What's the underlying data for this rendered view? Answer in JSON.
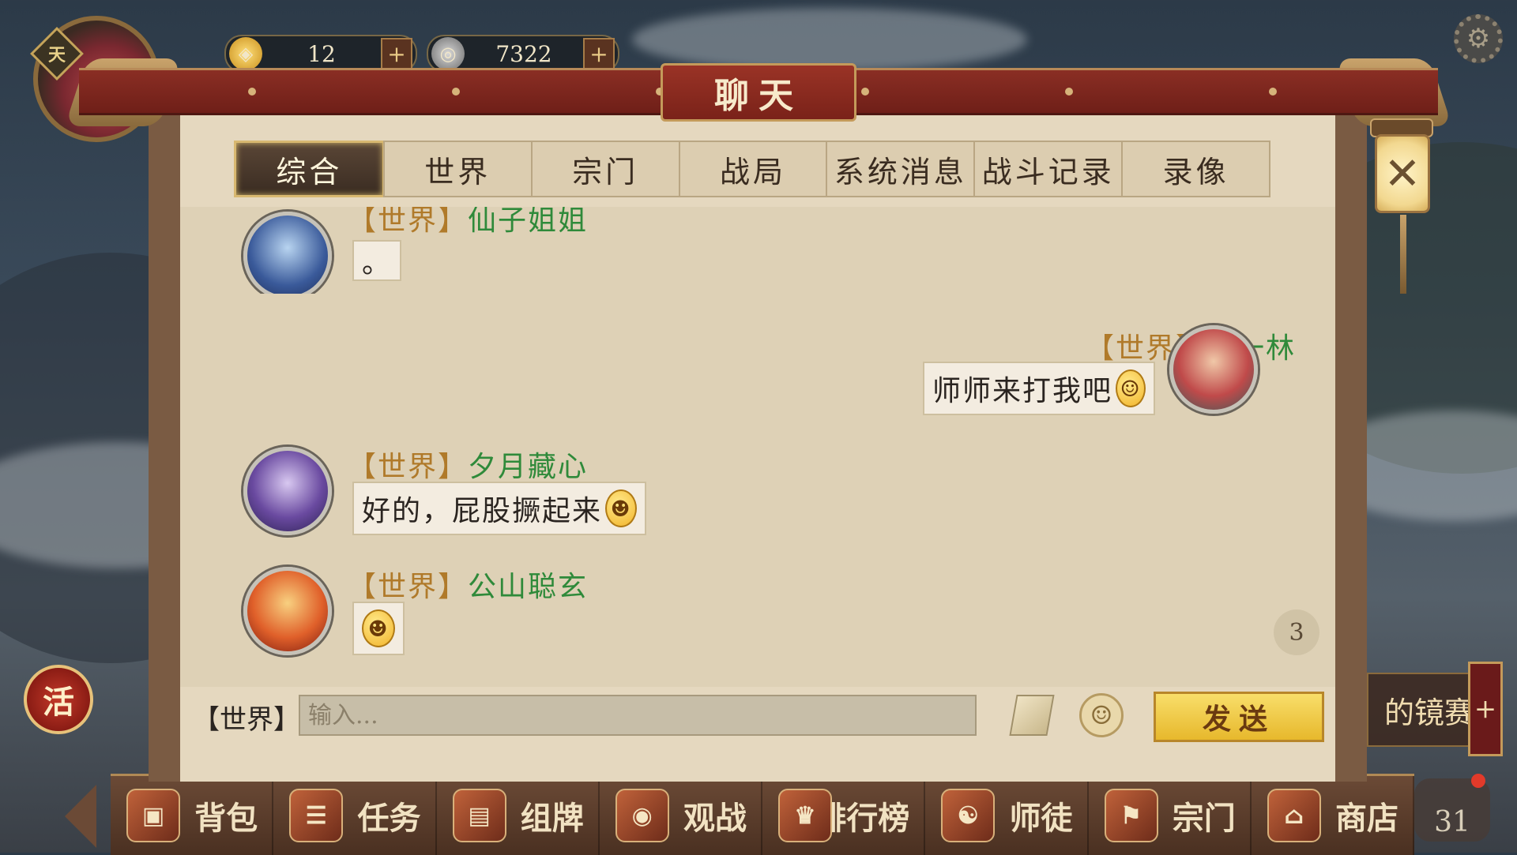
{
  "hud": {
    "rank_badge": "天",
    "gold": {
      "icon": "gold-ingot-icon",
      "value": "12",
      "plus": "+"
    },
    "coins": {
      "icon": "coin-icon",
      "value": "7322",
      "plus": "+"
    },
    "activity_icon_label": "活",
    "event_label": "的镜赛",
    "event_plus": "+",
    "notification_count": "31"
  },
  "dialog": {
    "title": "聊天",
    "tabs": [
      {
        "label": "综合",
        "active": true
      },
      {
        "label": "世界",
        "active": false
      },
      {
        "label": "宗门",
        "active": false
      },
      {
        "label": "战局",
        "active": false
      },
      {
        "label": "系统消息",
        "active": false
      },
      {
        "label": "战斗记录",
        "active": false
      },
      {
        "label": "录像",
        "active": false
      }
    ],
    "messages": [
      {
        "channel": "【世界】",
        "name": "仙子姐姐",
        "text": "。",
        "emoji": "",
        "side": "left"
      },
      {
        "channel": "【世界】",
        "name": "雨一林",
        "text": "师师来打我吧",
        "emoji": "blush-emoji",
        "side": "right"
      },
      {
        "channel": "【世界】",
        "name": "夕月藏心",
        "text": "好的，屁股撅起来",
        "emoji": "smirk-emoji",
        "side": "left"
      },
      {
        "channel": "【世界】",
        "name": "公山聪玄",
        "text": "",
        "emoji": "smirk-emoji",
        "side": "left"
      }
    ],
    "unread_count": "3",
    "input": {
      "channel_label": "【世界】",
      "placeholder": "输入...",
      "value": ""
    },
    "send_label": "发送",
    "close_icon": "close-icon"
  },
  "bottom_nav": [
    {
      "label": "背包",
      "icon": "backpack-icon"
    },
    {
      "label": "任务",
      "icon": "task-scroll-icon"
    },
    {
      "label": "组牌",
      "icon": "card-deck-icon"
    },
    {
      "label": "观战",
      "icon": "spectate-icon"
    },
    {
      "label": "排行榜",
      "icon": "ranking-icon"
    },
    {
      "label": "师徒",
      "icon": "mentor-icon"
    },
    {
      "label": "宗门",
      "icon": "sect-icon"
    },
    {
      "label": "商店",
      "icon": "shop-icon"
    }
  ],
  "colors": {
    "title_red": "#7a2219",
    "frame_brown": "#7a5b43",
    "parchment": "#e5d8bf",
    "channel_gold": "#b07a2a",
    "name_green": "#2f8a3a",
    "send_gold": "#f2c84a"
  }
}
